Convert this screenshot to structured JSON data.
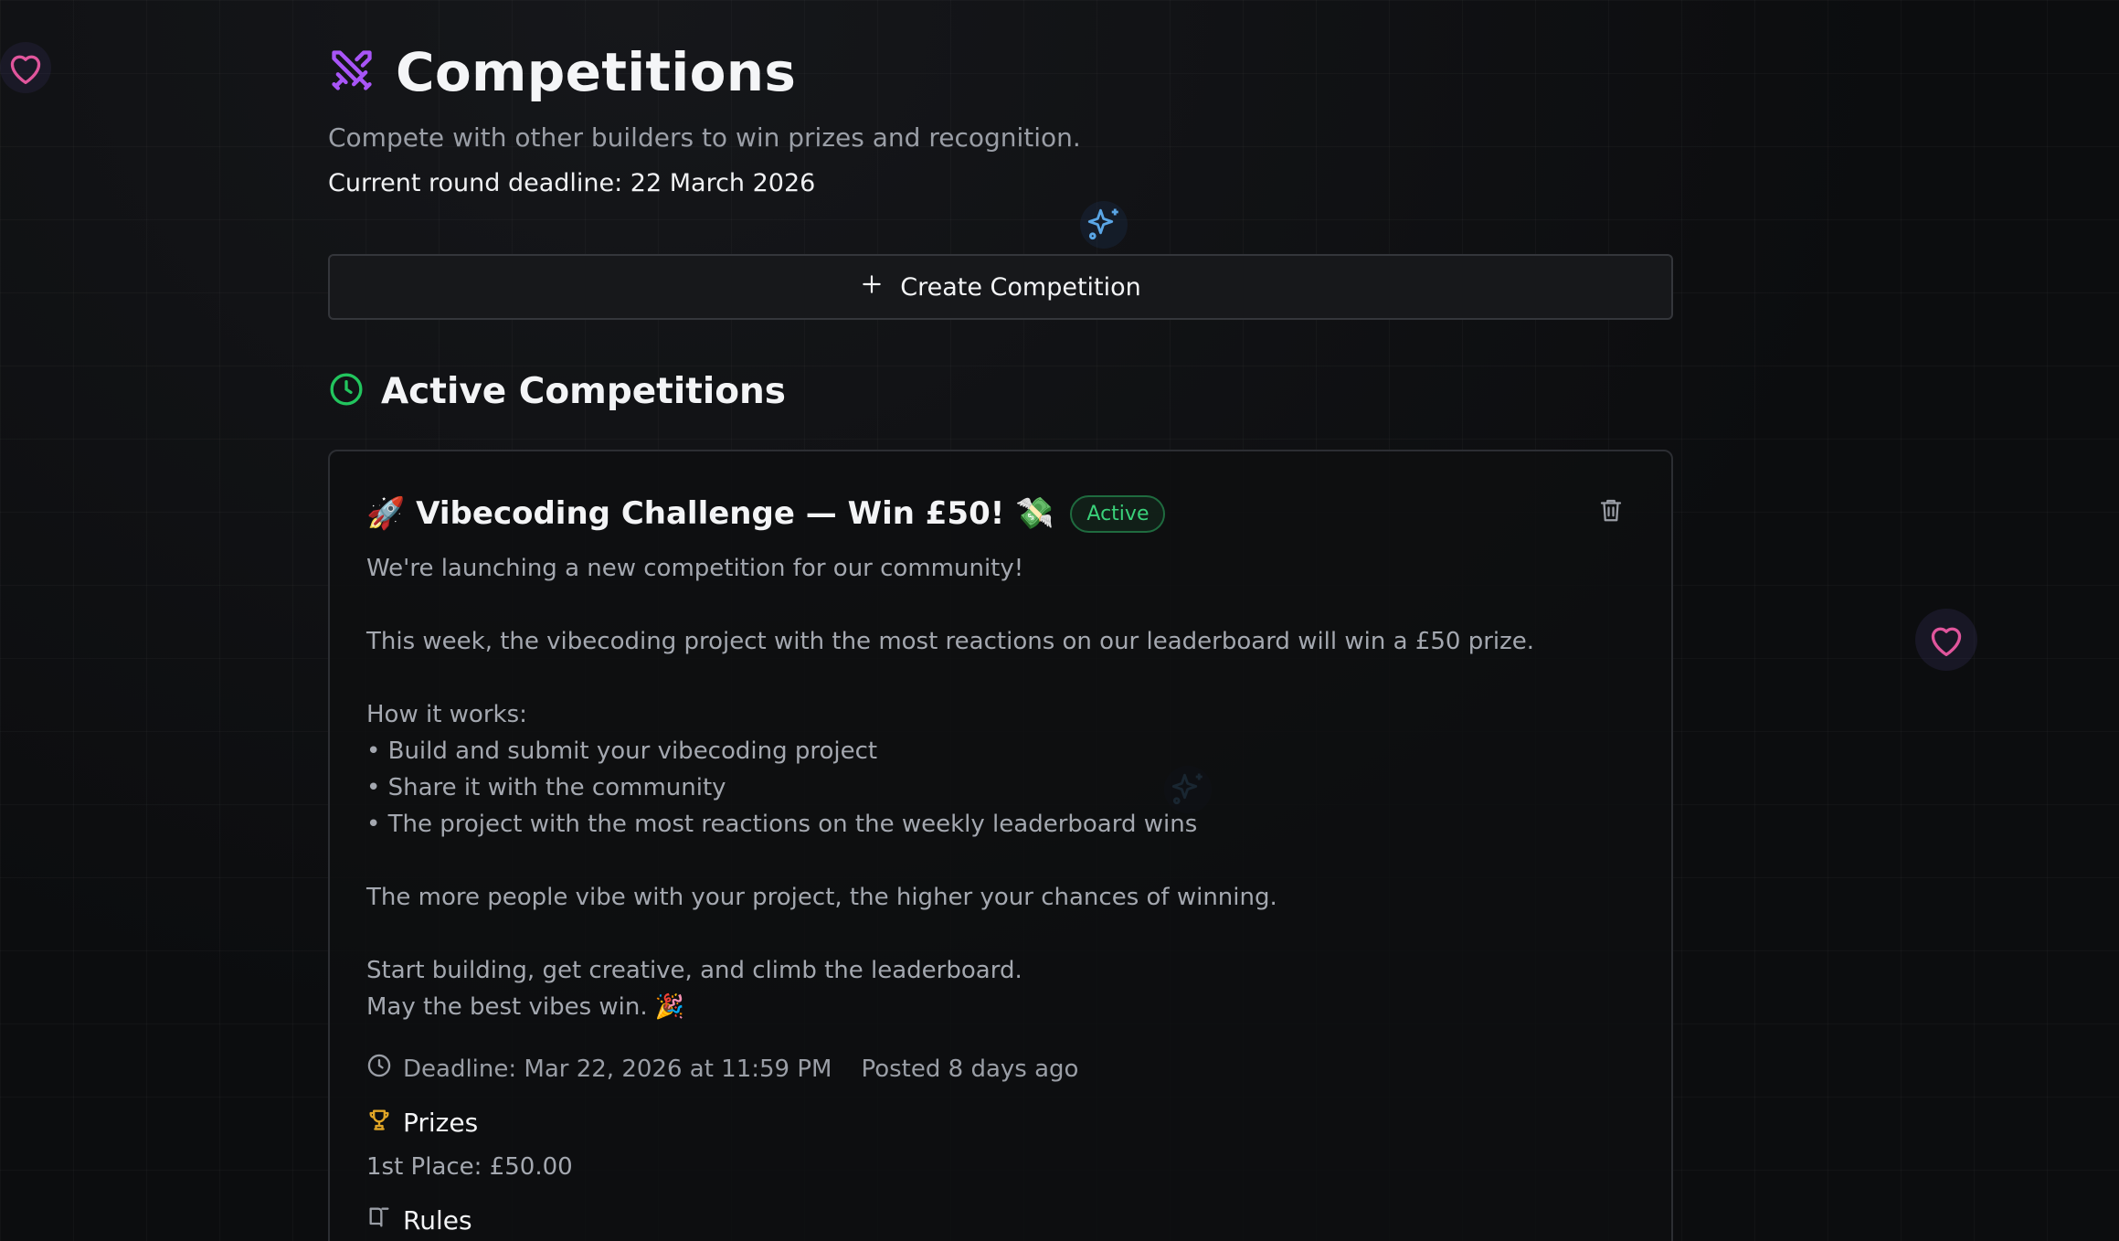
{
  "header": {
    "title": "Competitions",
    "subtitle": "Compete with other builders to win prizes and recognition.",
    "deadline_text": "Current round deadline: 22 March 2026"
  },
  "create_button": {
    "label": "Create Competition"
  },
  "active_section": {
    "title": "Active Competitions"
  },
  "competition": {
    "title": "🚀 Vibecoding Challenge — Win £50! 💸",
    "status": "Active",
    "description": [
      "We're launching a new competition for our community!",
      "",
      "This week, the vibecoding project with the most reactions on our leaderboard will win a £50 prize.",
      "",
      "How it works:",
      "• Build and submit your vibecoding project",
      "• Share it with the community",
      "• The project with the most reactions on the weekly leaderboard wins",
      "",
      "The more people vibe with your project, the higher your chances of winning.",
      "",
      "Start building, get creative, and climb the leaderboard.",
      "May the best vibes win. 🎉"
    ],
    "deadline": "Deadline: Mar 22, 2026 at 11:59 PM",
    "posted": "Posted 8 days ago",
    "prizes_label": "Prizes",
    "prize_first": "1st Place: £50.00",
    "rules_label": "Rules"
  },
  "colors": {
    "accent_purple": "#a855f7",
    "active_green": "#3ad17a",
    "trophy_gold": "#e0a526",
    "heart_pink": "#e0559c",
    "sparkle_blue": "#5aa6e6"
  },
  "icons": {
    "title": "crossed-swords-icon",
    "create": "plus-icon",
    "section": "clock-icon",
    "delete": "trash-icon",
    "deadline": "clock-icon",
    "prizes": "trophy-icon",
    "rules": "book-icon",
    "decor": [
      "heart-icon",
      "sparkles-icon"
    ]
  }
}
